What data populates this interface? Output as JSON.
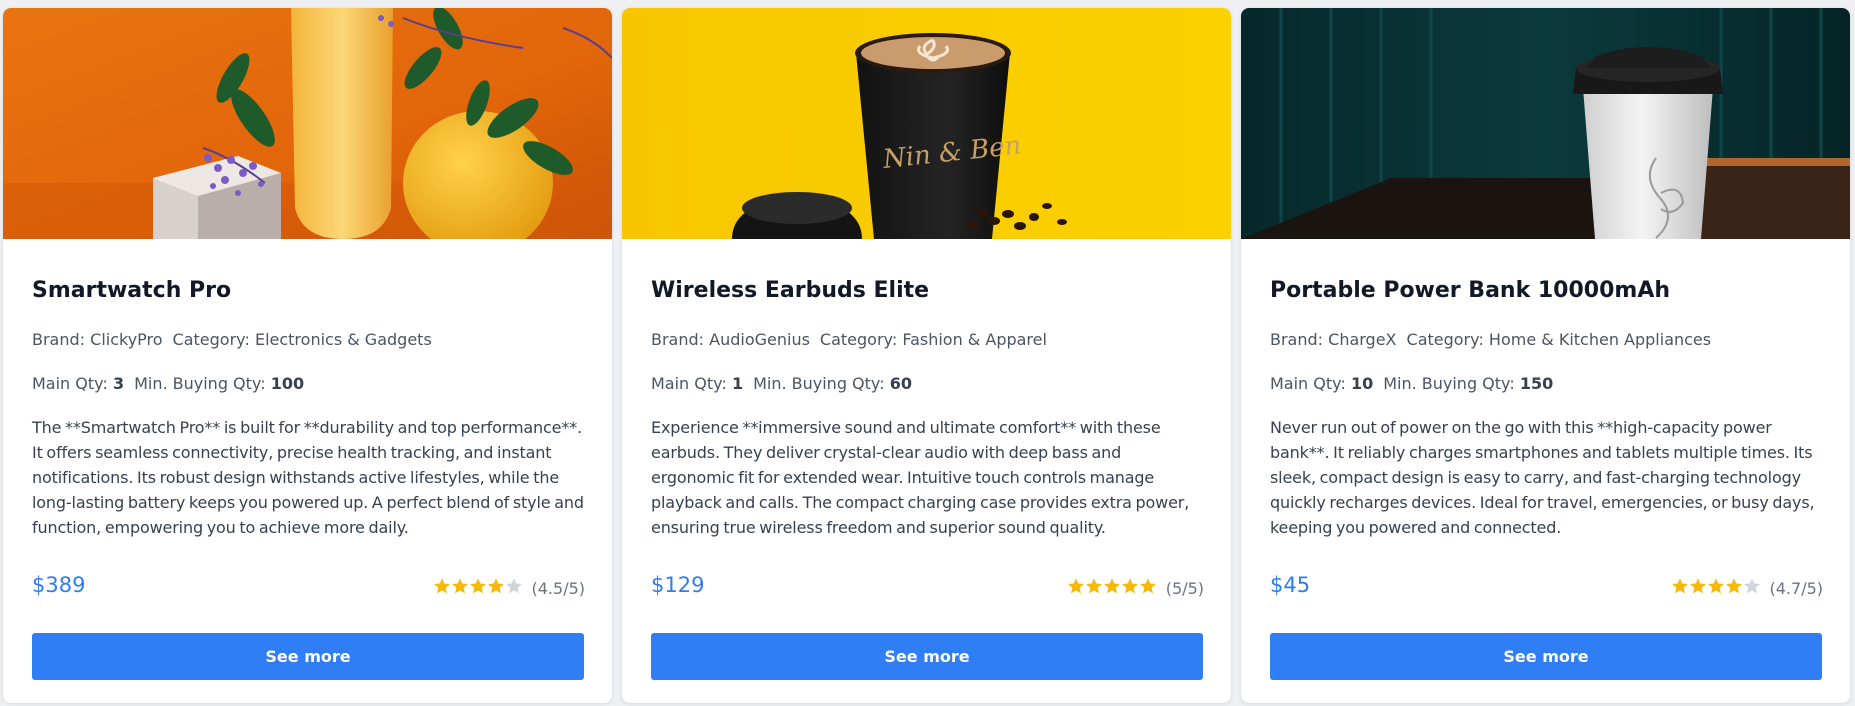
{
  "colors": {
    "accent": "#2f7ef5",
    "price": "#2f7bf0",
    "star_filled": "#f5b90a",
    "star_empty": "#d1d5db"
  },
  "products": [
    {
      "title": "Smartwatch Pro",
      "brand_label": "Brand:",
      "brand": "ClickyPro",
      "category_label": "Category:",
      "category": "Electronics & Gadgets",
      "main_qty_label": "Main Qty:",
      "main_qty": "3",
      "min_qty_label": "Min. Buying Qty:",
      "min_qty": "100",
      "description": "The **Smartwatch Pro** is built for **durability and top performance**. It offers seamless connectivity, precise health tracking, and instant notifications. Its robust design withstands active lifestyles, while the long-lasting battery keeps you powered up. A perfect blend of style and function, empowering you to achieve more daily.",
      "price": "$389",
      "stars_filled": 4,
      "rating_text": "(4.5/5)",
      "button_label": "See more",
      "image_icon": "orange-product-photo"
    },
    {
      "title": "Wireless Earbuds Elite",
      "brand_label": "Brand:",
      "brand": "AudioGenius",
      "category_label": "Category:",
      "category": "Fashion & Apparel",
      "main_qty_label": "Main Qty:",
      "main_qty": "1",
      "min_qty_label": "Min. Buying Qty:",
      "min_qty": "60",
      "description": "Experience **immersive sound and ultimate comfort** with these earbuds. They deliver crystal-clear audio with deep bass and ergonomic fit for extended wear. Intuitive touch controls manage playback and calls. The compact charging case provides extra power, ensuring true wireless freedom and superior sound quality.",
      "price": "$129",
      "stars_filled": 5,
      "rating_text": "(5/5)",
      "button_label": "See more",
      "image_icon": "yellow-coffee-cup-photo",
      "image_cup_text": "Nin & Ben"
    },
    {
      "title": "Portable Power Bank 10000mAh",
      "brand_label": "Brand:",
      "brand": "ChargeX",
      "category_label": "Category:",
      "category": "Home & Kitchen Appliances",
      "main_qty_label": "Main Qty:",
      "main_qty": "10",
      "min_qty_label": "Min. Buying Qty:",
      "min_qty": "150",
      "description": "Never run out of power on the go with this **high-capacity power bank**. It reliably charges smartphones and tablets multiple times. Its sleek, compact design is easy to carry, and fast-charging technology quickly recharges devices. Ideal for travel, emergencies, or busy days, keeping you powered and connected.",
      "price": "$45",
      "stars_filled": 4,
      "rating_text": "(4.7/5)",
      "button_label": "See more",
      "image_icon": "teal-coffee-cup-photo"
    }
  ]
}
